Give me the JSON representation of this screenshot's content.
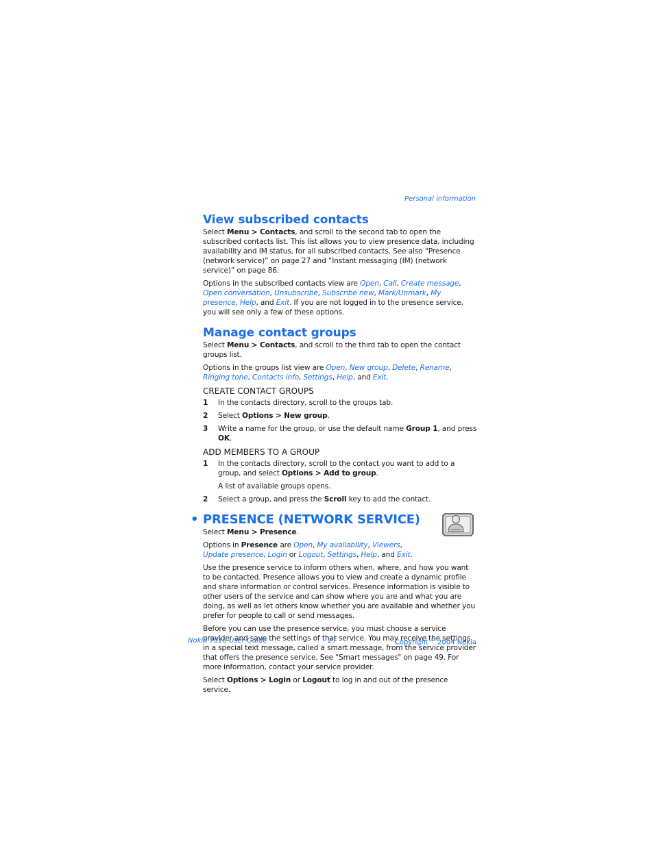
{
  "running_head": "Personal information",
  "section1": {
    "title": "View subscribed contacts",
    "p1": {
      "pre": "Select ",
      "b1": "Menu > Contacts",
      "post": ", and scroll to the second tab to open the subscribed contacts list. This list allows you to view presence data, including availability and IM status, for all subscribed contacts. See also “Presence (network service)” on page 27 and “Instant messaging (IM) (network service)” on page 86."
    },
    "p2": {
      "pre": "Options in the subscribed contacts view are ",
      "options": [
        "Open",
        "Call",
        "Create message",
        "Open conversation",
        "Unsubscribe",
        "Subscribe new",
        "Mark/Unmark",
        "My presence",
        "Help",
        "Exit"
      ],
      "post": "If you are not logged in to the presence service, you will see only a few of these options."
    }
  },
  "section2": {
    "title": "Manage contact groups",
    "p1": {
      "pre": "Select ",
      "b1": "Menu > Contacts",
      "post": ", and scroll to the third tab to open the contact groups list."
    },
    "p2": {
      "pre": "Options in the groups list view are ",
      "options": [
        "Open",
        "New group",
        "Delete",
        "Rename",
        "Ringing tone",
        "Contacts info",
        "Settings",
        "Help",
        "Exit"
      ]
    },
    "sub1": {
      "title": "Create contact groups",
      "steps": [
        {
          "num": "1",
          "text": "In the contacts directory, scroll to the groups tab."
        },
        {
          "num": "2",
          "pre": "Select ",
          "b1": "Options > New group",
          "post": "."
        },
        {
          "num": "3",
          "pre": "Write a name for the group, or use the default name ",
          "b1": "Group 1",
          "mid": ", and press ",
          "b2": "OK",
          "post": "."
        }
      ]
    },
    "sub2": {
      "title": "Add members to a group",
      "steps": [
        {
          "num": "1",
          "pre": "In the contacts directory, scroll to the contact you want to add to a group, and select ",
          "b1": "Options > Add to group",
          "post": ".",
          "note": "A list of available groups opens."
        },
        {
          "num": "2",
          "pre": "Select a group, and press the ",
          "b1": "Scroll",
          "post": " key to add the contact."
        }
      ]
    }
  },
  "section3": {
    "bullet": "•",
    "title": "Presence (network service)",
    "icon": "presence-app-icon",
    "p1": {
      "pre": "Select ",
      "b1": "Menu > Presence",
      "post": "."
    },
    "p2": {
      "pre": "Options in ",
      "b1": "Presence",
      "mid": " are ",
      "options": [
        "Open",
        "My availability",
        "Viewers",
        "Update presence",
        "Login",
        "Logout",
        "Settings",
        "Help",
        "Exit"
      ]
    },
    "p3": "Use the presence service to inform others when, where, and how you want to be contacted. Presence allows you to view and create a dynamic profile and share information or control services. Presence information is visible to other users of the service and can show where you are and what you are doing, as well as let others know whether you are available and whether you prefer for people to call or send messages.",
    "p4": "Before you can use the presence service, you must choose a service provider and save the settings of that service. You may receive the settings in a special text message, called a smart message, from the service provider that offers the presence service. See \"Smart messages\" on page 49. For more information, contact your service provider.",
    "p5": {
      "pre": "Select ",
      "b1": "Options > Login",
      "mid": " or ",
      "b2": "Logout",
      "post": " to log in and out of the presence service."
    }
  },
  "footer": {
    "left": "Nokia 7610 User Guide",
    "page": "27",
    "right_pre": "Copyright ",
    "right_sym": "©",
    "right_post": " 2004 Nokia"
  },
  "colors": {
    "accent": "#1a6fe8",
    "text": "#1a1a1a"
  }
}
